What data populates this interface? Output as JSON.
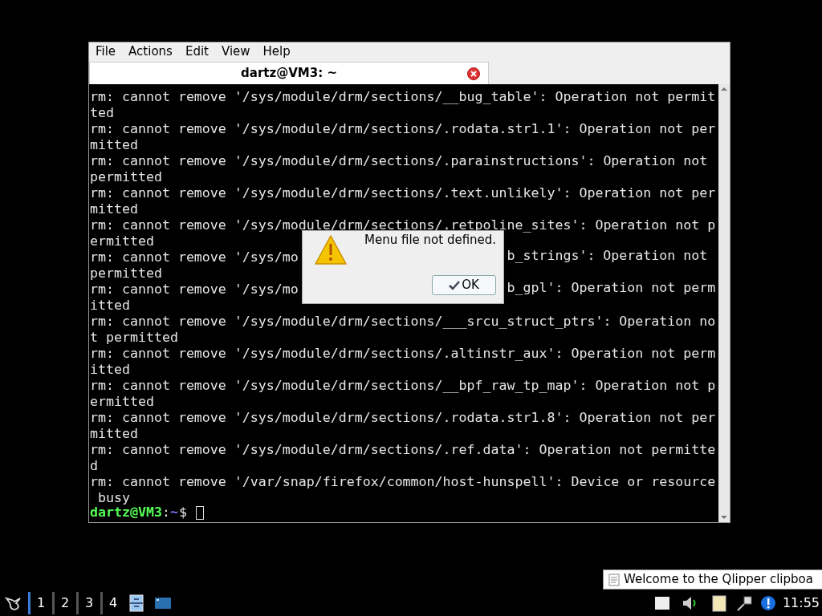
{
  "window": {
    "menu": [
      "File",
      "Actions",
      "Edit",
      "View",
      "Help"
    ],
    "tab": {
      "title": "dartz@VM3: ~"
    }
  },
  "terminal": {
    "lines": [
      {
        "kind": "full",
        "text": "rm: cannot remove '/sys/module/drm/sections/__bug_table': Operation not permit"
      },
      {
        "kind": "full",
        "text": "ted"
      },
      {
        "kind": "full",
        "text": "rm: cannot remove '/sys/module/drm/sections/.rodata.str1.1': Operation not per"
      },
      {
        "kind": "full",
        "text": "mitted"
      },
      {
        "kind": "full",
        "text": "rm: cannot remove '/sys/module/drm/sections/.parainstructions': Operation not"
      },
      {
        "kind": "full",
        "text": "permitted"
      },
      {
        "kind": "full",
        "text": "rm: cannot remove '/sys/module/drm/sections/.text.unlikely': Operation not per"
      },
      {
        "kind": "full",
        "text": "mitted"
      },
      {
        "kind": "full",
        "text": "rm: cannot remove '/sys/module/drm/sections/.retpoline_sites': Operation not p"
      },
      {
        "kind": "full",
        "text": "ermitted"
      },
      {
        "kind": "split",
        "left": "rm: cannot remove '/sys/mo",
        "right": "b_strings': Operation not"
      },
      {
        "kind": "full",
        "text": "permitted"
      },
      {
        "kind": "split",
        "left": "rm: cannot remove '/sys/mo",
        "right": "b_gpl': Operation not perm"
      },
      {
        "kind": "full",
        "text": "itted"
      },
      {
        "kind": "full",
        "text": "rm: cannot remove '/sys/module/drm/sections/___srcu_struct_ptrs': Operation no"
      },
      {
        "kind": "full",
        "text": "t permitted"
      },
      {
        "kind": "full",
        "text": "rm: cannot remove '/sys/module/drm/sections/.altinstr_aux': Operation not perm"
      },
      {
        "kind": "full",
        "text": "itted"
      },
      {
        "kind": "full",
        "text": "rm: cannot remove '/sys/module/drm/sections/__bpf_raw_tp_map': Operation not p"
      },
      {
        "kind": "full",
        "text": "ermitted"
      },
      {
        "kind": "full",
        "text": "rm: cannot remove '/sys/module/drm/sections/.rodata.str1.8': Operation not per"
      },
      {
        "kind": "full",
        "text": "mitted"
      },
      {
        "kind": "full",
        "text": "rm: cannot remove '/sys/module/drm/sections/.ref.data': Operation not permitte"
      },
      {
        "kind": "full",
        "text": "d"
      },
      {
        "kind": "full",
        "text": "rm: cannot remove '/var/snap/firefox/common/host-hunspell': Device or resource"
      },
      {
        "kind": "full",
        "text": " busy"
      }
    ],
    "prompt": {
      "user_host": "dartz@VM3",
      "colon": ":",
      "path": "~",
      "symbol": "$"
    }
  },
  "dialog": {
    "message": "Menu file not defined.",
    "button": "OK"
  },
  "notification": {
    "text": "Welcome to the Qlipper clipboa"
  },
  "taskbar": {
    "desktops": [
      {
        "label": "1",
        "selected": true
      },
      {
        "label": "2",
        "selected": false
      },
      {
        "label": "3",
        "selected": false
      },
      {
        "label": "4",
        "selected": false
      }
    ],
    "clock": "11:55"
  }
}
